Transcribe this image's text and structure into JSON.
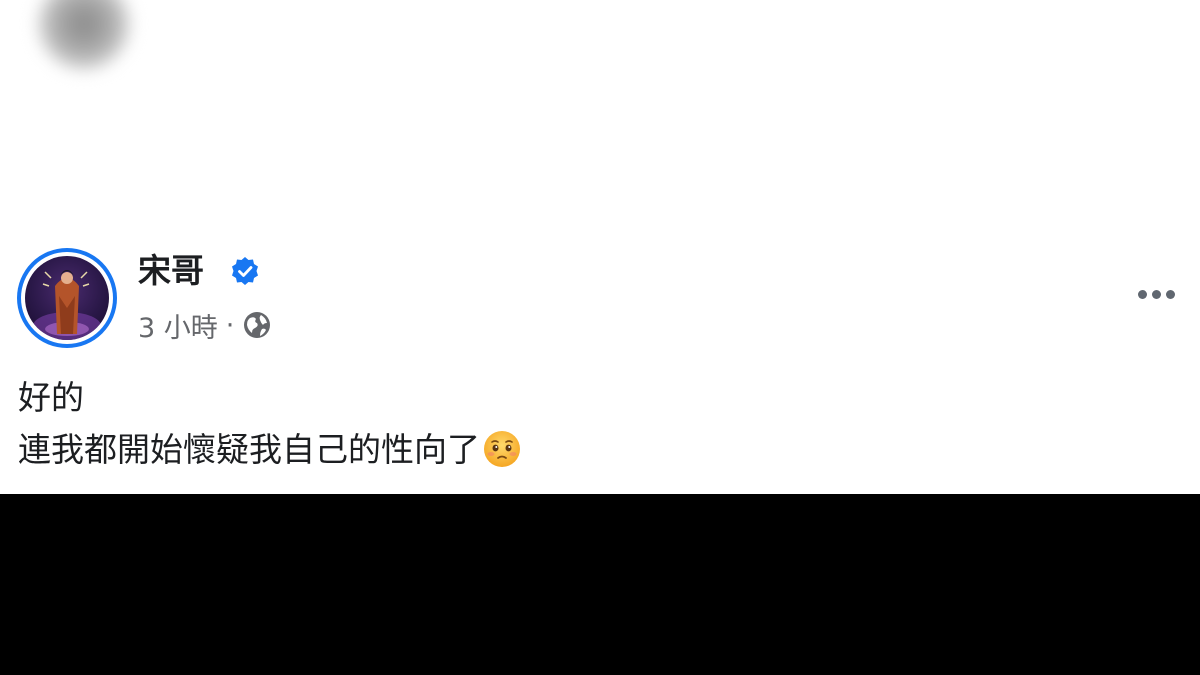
{
  "post": {
    "author_name": "宋哥",
    "verified": true,
    "timestamp": "3 小時",
    "separator": "·",
    "audience_icon": "globe-icon",
    "more_icon": "more-options-icon",
    "lines": [
      "好的",
      "連我都開始懷疑我自己的性向了"
    ],
    "emoji": "pleading-face-emoji"
  },
  "colors": {
    "verified_blue": "#1877f2",
    "text_primary": "#1c1e21",
    "text_secondary": "#65676b",
    "card_background": "#ffffff",
    "below_card": "#000000"
  }
}
